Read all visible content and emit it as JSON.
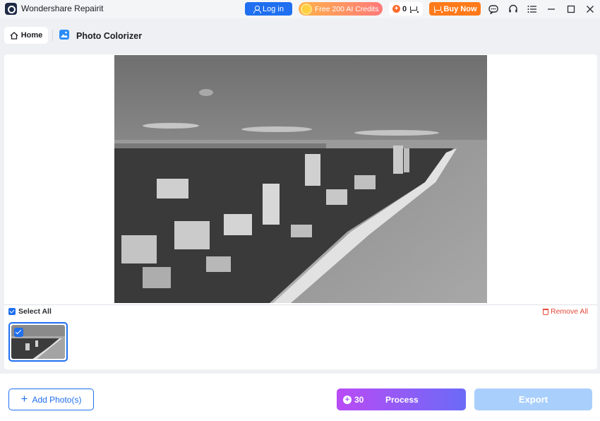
{
  "titlebar": {
    "app_name": "Wondershare Repairit",
    "login_label": "Log in",
    "credits_label": "Free 200 AI Credits",
    "cart_count": "0",
    "buy_label": "Buy Now",
    "window_icons": [
      "feedback-icon",
      "headset-icon",
      "menu-icon",
      "minimize-icon",
      "maximize-icon",
      "close-icon"
    ]
  },
  "nav": {
    "home_label": "Home",
    "page_title": "Photo Colorizer"
  },
  "gallery": {
    "select_all_label": "Select All",
    "remove_all_label": "Remove All",
    "thumbnails": [
      {
        "selected": true
      }
    ]
  },
  "footer": {
    "add_label": "Add Photo(s)",
    "credit_cost": "30",
    "process_label": "Process",
    "export_label": "Export"
  },
  "colors": {
    "primary": "#1f6ff0",
    "buy_orange": "#ff7a1a",
    "remove_red": "#e5483a",
    "export_disabled": "#a9cffc"
  }
}
